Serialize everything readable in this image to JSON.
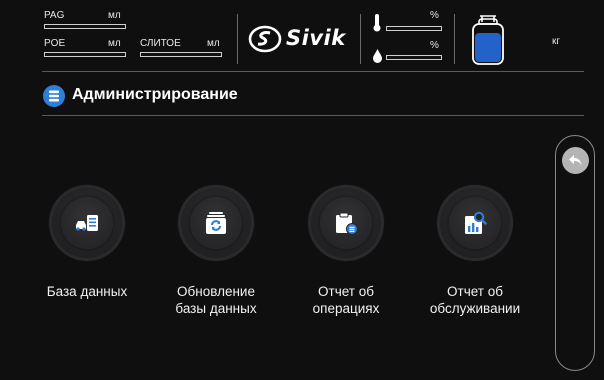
{
  "status": {
    "pag": {
      "label": "PAG",
      "unit": "мл"
    },
    "poe": {
      "label": "POE",
      "unit": "мл"
    },
    "drain": {
      "label": "СЛИТОЕ",
      "unit": "мл"
    },
    "brand": "Sivik",
    "temp_unit": "%",
    "humidity_unit": "%",
    "weight_unit": "кг"
  },
  "page": {
    "title": "Администрирование"
  },
  "tiles": [
    {
      "label": "База данных",
      "icon": "database-cars-icon"
    },
    {
      "label": "Обновление\nбазы данных",
      "icon": "database-refresh-icon"
    },
    {
      "label": "Отчет об\nоперациях",
      "icon": "operations-report-icon"
    },
    {
      "label": "Отчет об\nобслуживании",
      "icon": "service-report-icon"
    }
  ],
  "colors": {
    "accent_blue": "#2f7fd6",
    "cylinder_blue": "#2362c8",
    "background": "#0f0f10"
  }
}
